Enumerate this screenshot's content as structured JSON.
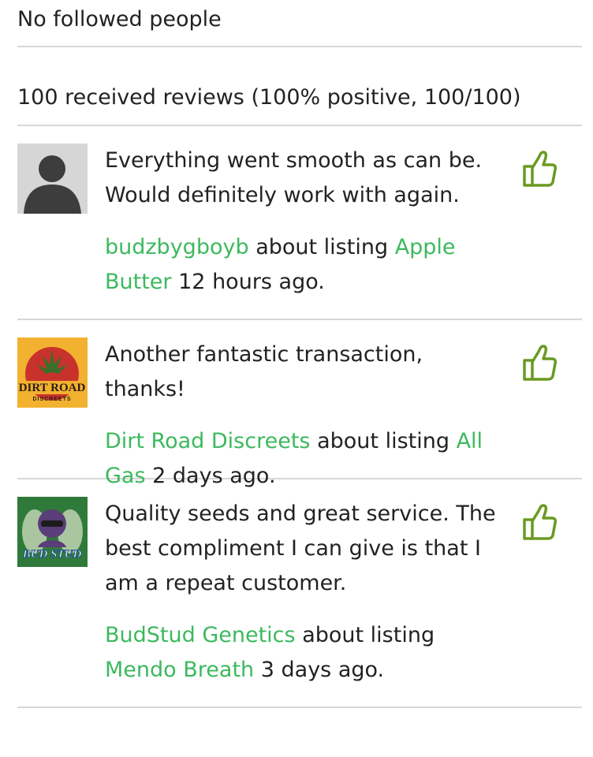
{
  "followed": {
    "text": "No followed people"
  },
  "summary": {
    "text": "100 received reviews (100% positive, 100/100)"
  },
  "reviews": [
    {
      "comment": "Everything went smooth as can be. Would definitely work with again.",
      "reviewer": "budzbygboyb",
      "about_text": "about listing",
      "listing": "Apple Butter",
      "time": "12 hours ago.",
      "avatar_icon": "default-user-icon"
    },
    {
      "comment": "Another fantastic transaction, thanks!",
      "reviewer": "Dirt Road Discreets",
      "about_text": "about listing",
      "listing": "All Gas",
      "time": "2 days ago.",
      "avatar_icon": "dirt-road-discreets-logo",
      "avatar_text": "DIRT ROAD",
      "avatar_subtext": "DISCREETS"
    },
    {
      "comment": "Quality seeds and great service. The best compliment I can give is that I am a repeat customer.",
      "reviewer": "BudStud Genetics",
      "about_text": "about listing",
      "listing": "Mendo Breath",
      "time": "3 days ago.",
      "avatar_icon": "budstud-logo",
      "avatar_text": "BUD STUD"
    }
  ],
  "colors": {
    "link": "#3cb95e",
    "thumb": "#6a9a22",
    "divider": "#d7d7d7"
  }
}
